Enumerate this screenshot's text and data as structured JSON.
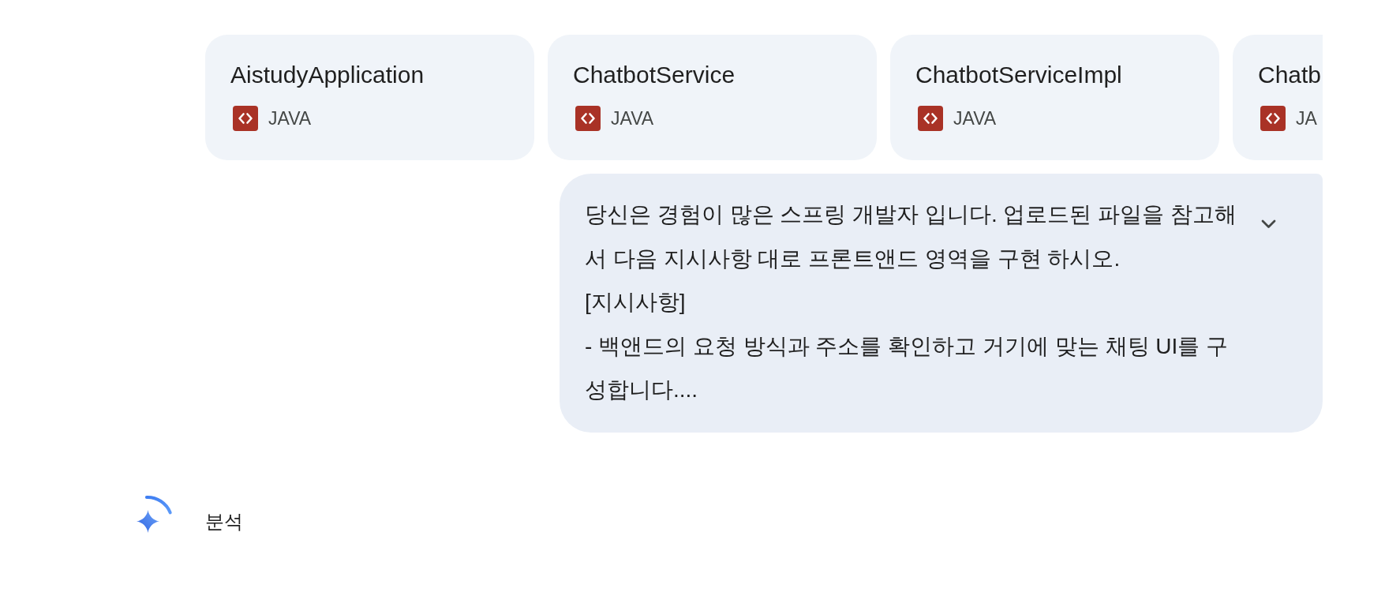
{
  "attachments": [
    {
      "name": "AistudyApplication",
      "type": "JAVA"
    },
    {
      "name": "ChatbotService",
      "type": "JAVA"
    },
    {
      "name": "ChatbotServiceImpl",
      "type": "JAVA"
    },
    {
      "name": "Chatb",
      "type": "JA"
    }
  ],
  "prompt": {
    "text": "당신은 경험이 많은 스프링 개발자 입니다. 업로드된 파일을 참고해서 다음 지시사항 대로 프론트앤드 영역을 구현 하시오.\n[지시사항]\n- 백앤드의 요청 방식과 주소를 확인하고 거기에 맞는 채팅 UI를 구성합니다....",
    "expanded": false
  },
  "response": {
    "loading": true,
    "status": "분석"
  }
}
